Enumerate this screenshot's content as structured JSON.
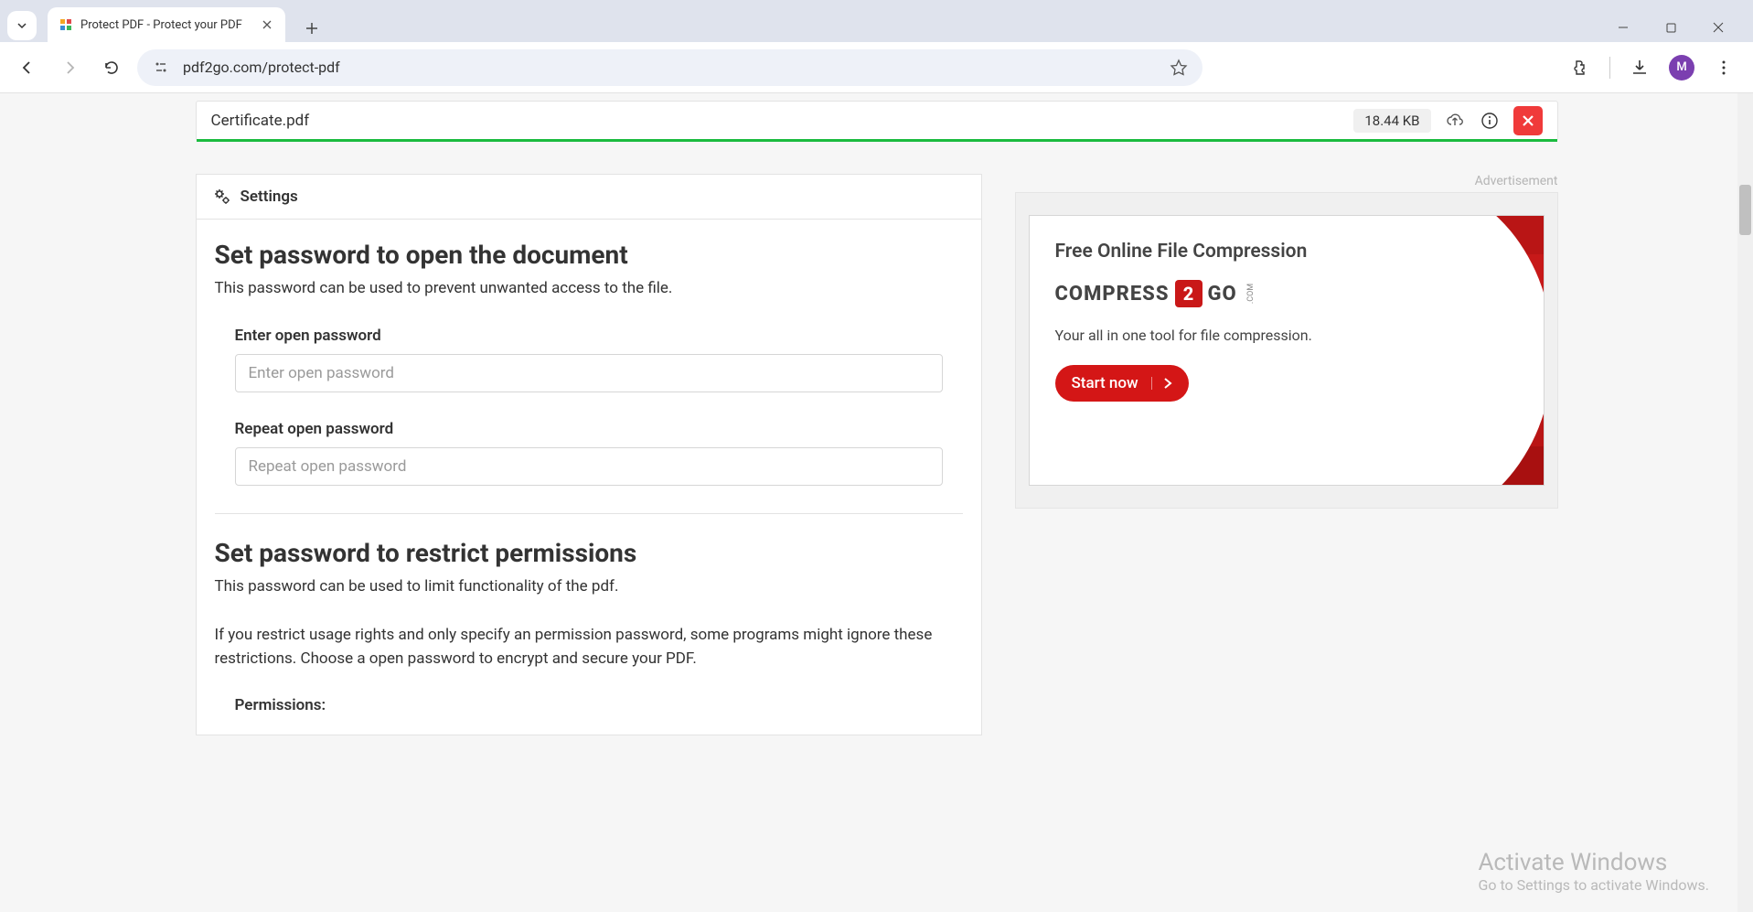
{
  "browser": {
    "tab_title": "Protect PDF - Protect your PDF",
    "url": "pdf2go.com/protect-pdf",
    "avatar_letter": "M"
  },
  "file": {
    "name": "Certificate.pdf",
    "size": "18.44 KB"
  },
  "settings": {
    "header": "Settings",
    "open_pw_title": "Set password to open the document",
    "open_pw_desc": "This password can be used to prevent unwanted access to the file.",
    "enter_label": "Enter open password",
    "enter_placeholder": "Enter open password",
    "repeat_label": "Repeat open password",
    "repeat_placeholder": "Repeat open password",
    "restrict_title": "Set password to restrict permissions",
    "restrict_desc1": "This password can be used to limit functionality of the pdf.",
    "restrict_desc2": "If you restrict usage rights and only specify an permission password, some programs might ignore these restrictions. Choose a open password to encrypt and secure your PDF.",
    "permissions_label": "Permissions:"
  },
  "ad": {
    "label": "Advertisement",
    "title": "Free Online File Compression",
    "logo1": "COMPRESS",
    "logo_badge": "2",
    "logo2": "GO",
    "logo_com": ".COM",
    "sub": "Your all in one tool for file compression.",
    "cta": "Start now"
  },
  "watermark": {
    "title": "Activate Windows",
    "sub": "Go to Settings to activate Windows."
  }
}
